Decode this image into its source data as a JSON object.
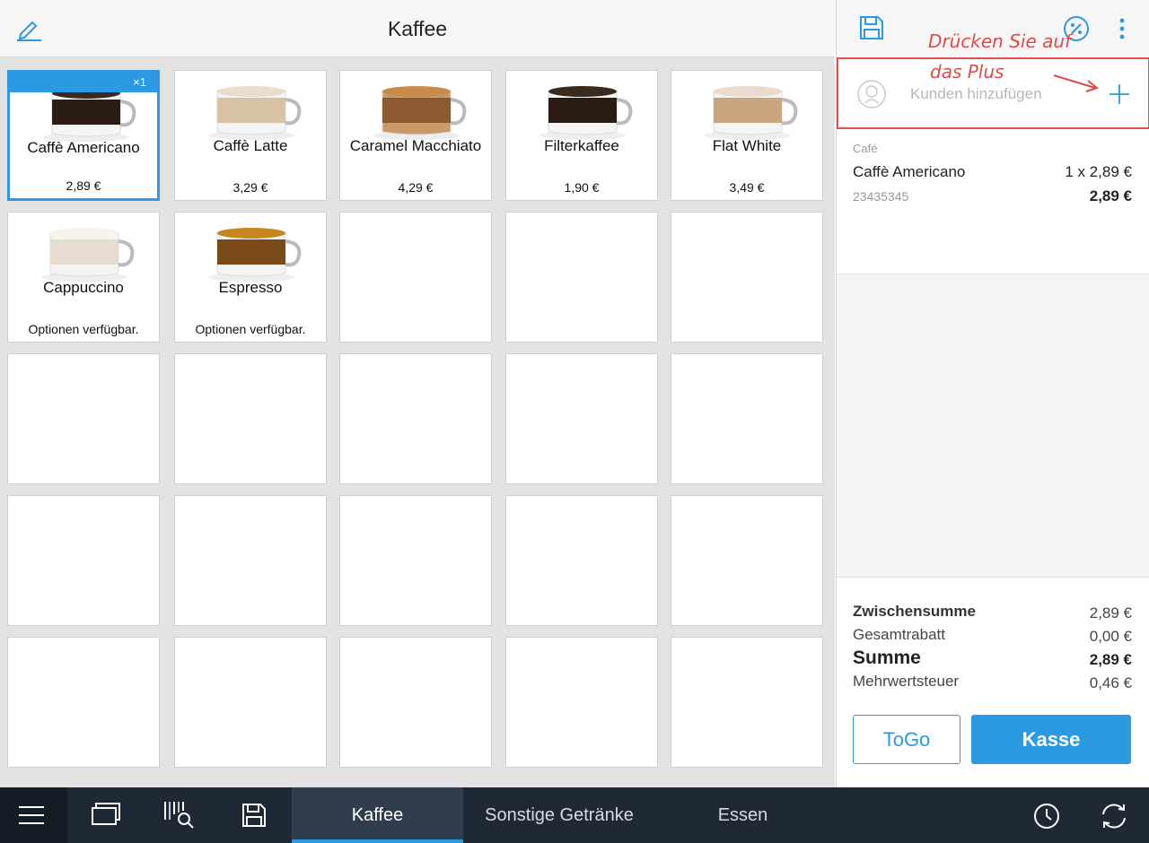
{
  "header": {
    "title": "Kaffee"
  },
  "products": [
    {
      "name": "Caffè Americano",
      "price": "2,89 €",
      "qty_badge": "×1",
      "selected": true,
      "cup": "black"
    },
    {
      "name": "Caffè Latte",
      "price": "3,29 €",
      "qty_badge": "",
      "selected": false,
      "cup": "latte"
    },
    {
      "name": "Caramel Macchiato",
      "price": "4,29 €",
      "qty_badge": "",
      "selected": false,
      "cup": "caramel"
    },
    {
      "name": "Filterkaffee",
      "price": "1,90 €",
      "qty_badge": "",
      "selected": false,
      "cup": "black"
    },
    {
      "name": "Flat White",
      "price": "3,49 €",
      "qty_badge": "",
      "selected": false,
      "cup": "flat"
    },
    {
      "name": "Cappuccino",
      "price": "Optionen verfügbar.",
      "qty_badge": "",
      "selected": false,
      "cup": "foam"
    },
    {
      "name": "Espresso",
      "price": "Optionen verfügbar.",
      "qty_badge": "",
      "selected": false,
      "cup": "espresso"
    }
  ],
  "customer": {
    "placeholder": "Kunden hinzufügen"
  },
  "annotation": {
    "line1": "Drücken Sie auf",
    "line2": "das Plus"
  },
  "order": {
    "category": "Café",
    "item_name": "Caffè Americano",
    "qty_price": "1 x 2,89 €",
    "sku": "23435345",
    "line_total": "2,89 €"
  },
  "totals": {
    "subtotal_label": "Zwischensumme",
    "subtotal": "2,89 €",
    "discount_label": "Gesamtrabatt",
    "discount": "0,00 €",
    "sum_label": "Summe",
    "sum": "2,89 €",
    "vat_label": "Mehrwertsteuer",
    "vat": "0,46 €"
  },
  "buttons": {
    "togo": "ToGo",
    "kasse": "Kasse"
  },
  "tabs": [
    {
      "label": "Kaffee",
      "active": true
    },
    {
      "label": "Sonstige Getränke",
      "active": false
    },
    {
      "label": "Essen",
      "active": false
    }
  ],
  "colors": {
    "accent": "#2b9ae3",
    "bottom_bar": "#1f2935",
    "annotation": "#e04a4a"
  }
}
